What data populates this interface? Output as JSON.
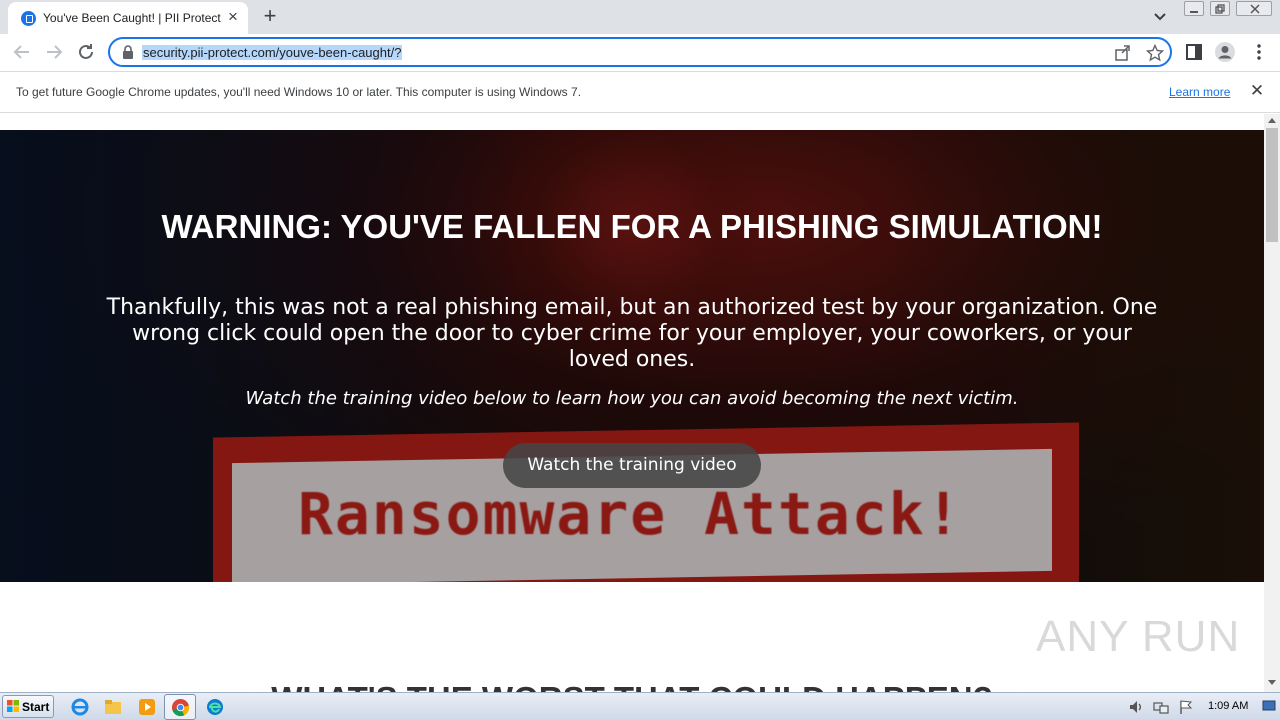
{
  "browser": {
    "tab": {
      "title": "You've Been Caught! | PII Protect",
      "favicon": "pii-protect-lock-icon"
    },
    "url": "security.pii-protect.com/youve-been-caught/?",
    "accent_color": "#1a73e8"
  },
  "infobar": {
    "message": "To get future Google Chrome updates, you'll need Windows 10 or later. This computer is using Windows 7.",
    "link": "Learn more"
  },
  "page": {
    "hero": {
      "title": "WARNING: YOU'VE FALLEN FOR A PHISHING SIMULATION!",
      "body": "Thankfully, this was not a real phishing email, but an authorized test by your organization. One wrong click could open the door to cyber crime for your employer, your coworkers, or your loved ones.",
      "italic": "Watch the training video below to learn how you can avoid becoming the next victim.",
      "button": "Watch the training video",
      "background_text": "Ransomware Attack!"
    },
    "next_heading": "WHAT'S THE WORST THAT COULD HAPPEN?"
  },
  "watermark": "ANY RUN",
  "taskbar": {
    "start_label": "Start",
    "clock": "1:09 AM",
    "pinned": [
      "ie-icon",
      "explorer-icon",
      "media-player-icon",
      "chrome-icon",
      "edge-icon"
    ]
  }
}
